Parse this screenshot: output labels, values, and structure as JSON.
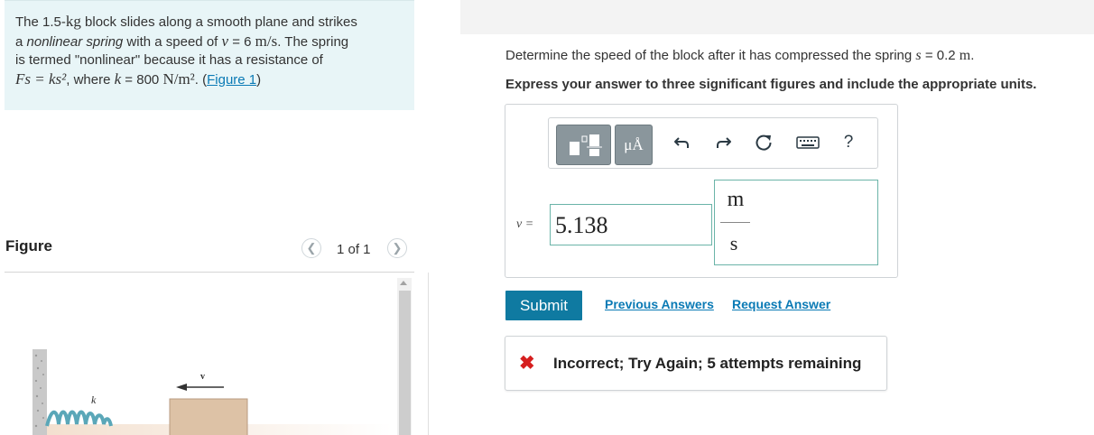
{
  "problem": {
    "line1_prefix": "The 1.5-",
    "line1_unit": "kg",
    "line1_suffix": " block slides along a smooth plane and strikes",
    "line2_prefix": "a ",
    "line2_italic": "nonlinear spring",
    "line2_mid": " with a speed of ",
    "line2_var": "v",
    "line2_eq": " = 6 ",
    "line2_unit": "m/s",
    "line2_suffix": ". The spring",
    "line3": "is termed \"nonlinear\" because it has a resistance of",
    "line4_formula": "Fs = ks²",
    "line4_mid": ", where ",
    "line4_k": "k",
    "line4_eq": " = 800 ",
    "line4_unit": "N/m²",
    "line4_dot": ". (",
    "figure_link": "Figure 1",
    "line4_close": ")"
  },
  "figure": {
    "label": "Figure",
    "page_indicator": "1 of 1",
    "prev_icon": "chevron-left-icon",
    "next_icon": "chevron-right-icon",
    "spring_label": "k",
    "velocity_label": "v"
  },
  "question": {
    "text": "Determine the speed of the block after it has compressed the spring ",
    "var": "s",
    "value": " = 0.2 ",
    "unit": "m",
    "end": "."
  },
  "instruction": "Express your answer to three significant figures and include the appropriate units.",
  "toolbar": {
    "templates_icon": "templates-icon",
    "units_label": "μÅ",
    "undo_icon": "undo-icon",
    "redo_icon": "redo-icon",
    "reset_icon": "reset-icon",
    "keyboard_icon": "keyboard-icon",
    "help_label": "?"
  },
  "answer": {
    "var_label": "v =",
    "value": "5.138",
    "unit_numerator": "m",
    "unit_denominator": "s"
  },
  "actions": {
    "submit": "Submit",
    "previous_answers": "Previous Answers",
    "request_answer": "Request Answer"
  },
  "feedback": {
    "icon": "x-icon",
    "text": "Incorrect; Try Again; 5 attempts remaining",
    "color": "#d61f1f"
  },
  "colors": {
    "problem_bg": "#e8f5f7",
    "submit_bg": "#0f7aa1",
    "link": "#0a7ab5",
    "input_border": "#6bb4a8"
  }
}
